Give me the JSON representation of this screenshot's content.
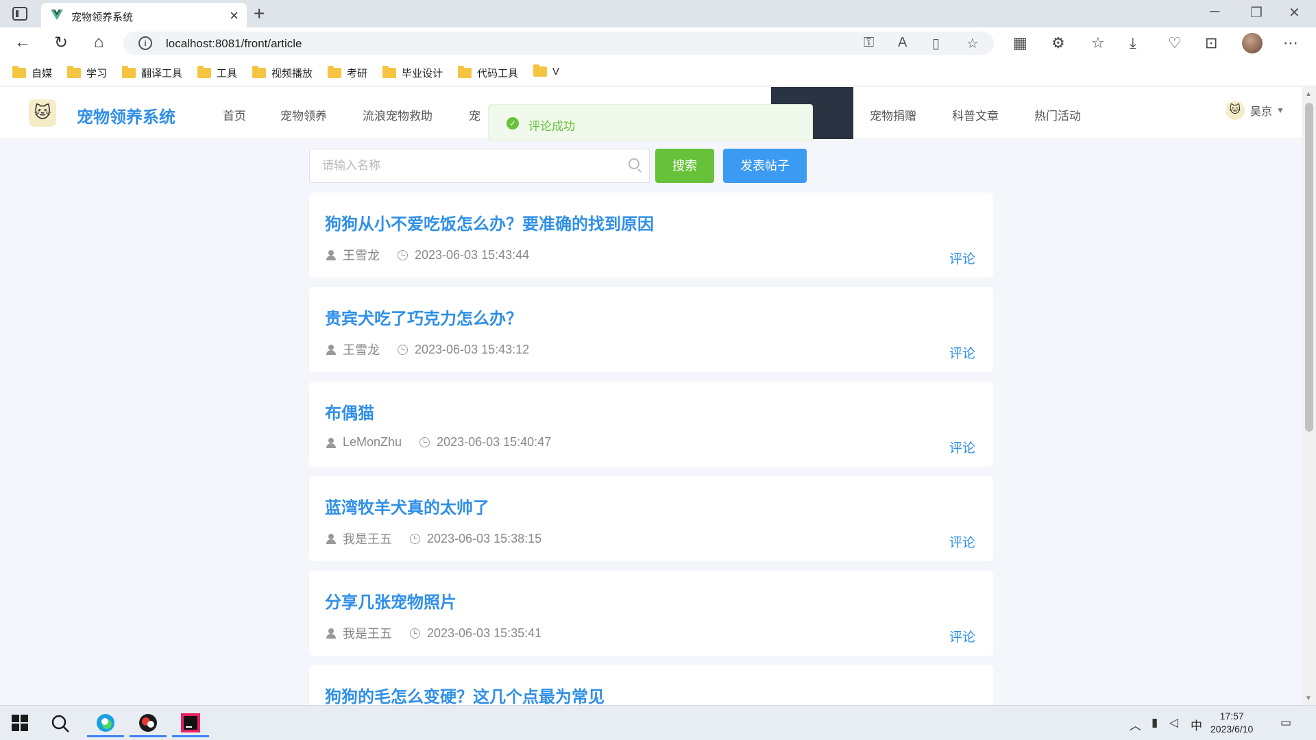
{
  "browser": {
    "tab_title": "宠物领养系统",
    "url": "localhost:8081/front/article",
    "bookmarks": [
      "自媒",
      "学习",
      "翻译工具",
      "工具",
      "视频播放",
      "考研",
      "毕业设计",
      "代码工具",
      "V"
    ]
  },
  "header": {
    "logo_title": "宠物领养系统",
    "nav": [
      "首页",
      "宠物领养",
      "流浪宠物救助",
      "宠",
      "宠物捐赠",
      "科普文章",
      "热门活动"
    ],
    "user_name": "吴京"
  },
  "toast": {
    "message": "评论成功"
  },
  "search": {
    "placeholder": "请输入名称",
    "search_label": "搜索",
    "post_label": "发表帖子"
  },
  "articles": [
    {
      "title": "狗狗从小不爱吃饭怎么办？要准确的找到原因",
      "author": "王雪龙",
      "time": "2023-06-03 15:43:44",
      "action": "评论"
    },
    {
      "title": "贵宾犬吃了巧克力怎么办？",
      "author": "王雪龙",
      "time": "2023-06-03 15:43:12",
      "action": "评论"
    },
    {
      "title": "布偶猫",
      "author": "LeMonZhu",
      "time": "2023-06-03 15:40:47",
      "action": "评论"
    },
    {
      "title": "蓝湾牧羊犬真的太帅了",
      "author": "我是王五",
      "time": "2023-06-03 15:38:15",
      "action": "评论"
    },
    {
      "title": "分享几张宠物照片",
      "author": "我是王五",
      "time": "2023-06-03 15:35:41",
      "action": "评论"
    },
    {
      "title": "狗狗的毛怎么变硬？这几个点最为常见",
      "author": "",
      "time": "",
      "action": ""
    }
  ],
  "taskbar": {
    "time": "17:57",
    "date": "2023/6/10",
    "ime": "中"
  },
  "colors": {
    "accent": "#2f8fe8",
    "success": "#67c23a",
    "header_dark": "#2a3342"
  },
  "icons": [
    "back-icon",
    "refresh-icon",
    "home-icon",
    "folder-icon",
    "search-icon",
    "user-icon",
    "clock-icon",
    "check-circle-icon"
  ]
}
